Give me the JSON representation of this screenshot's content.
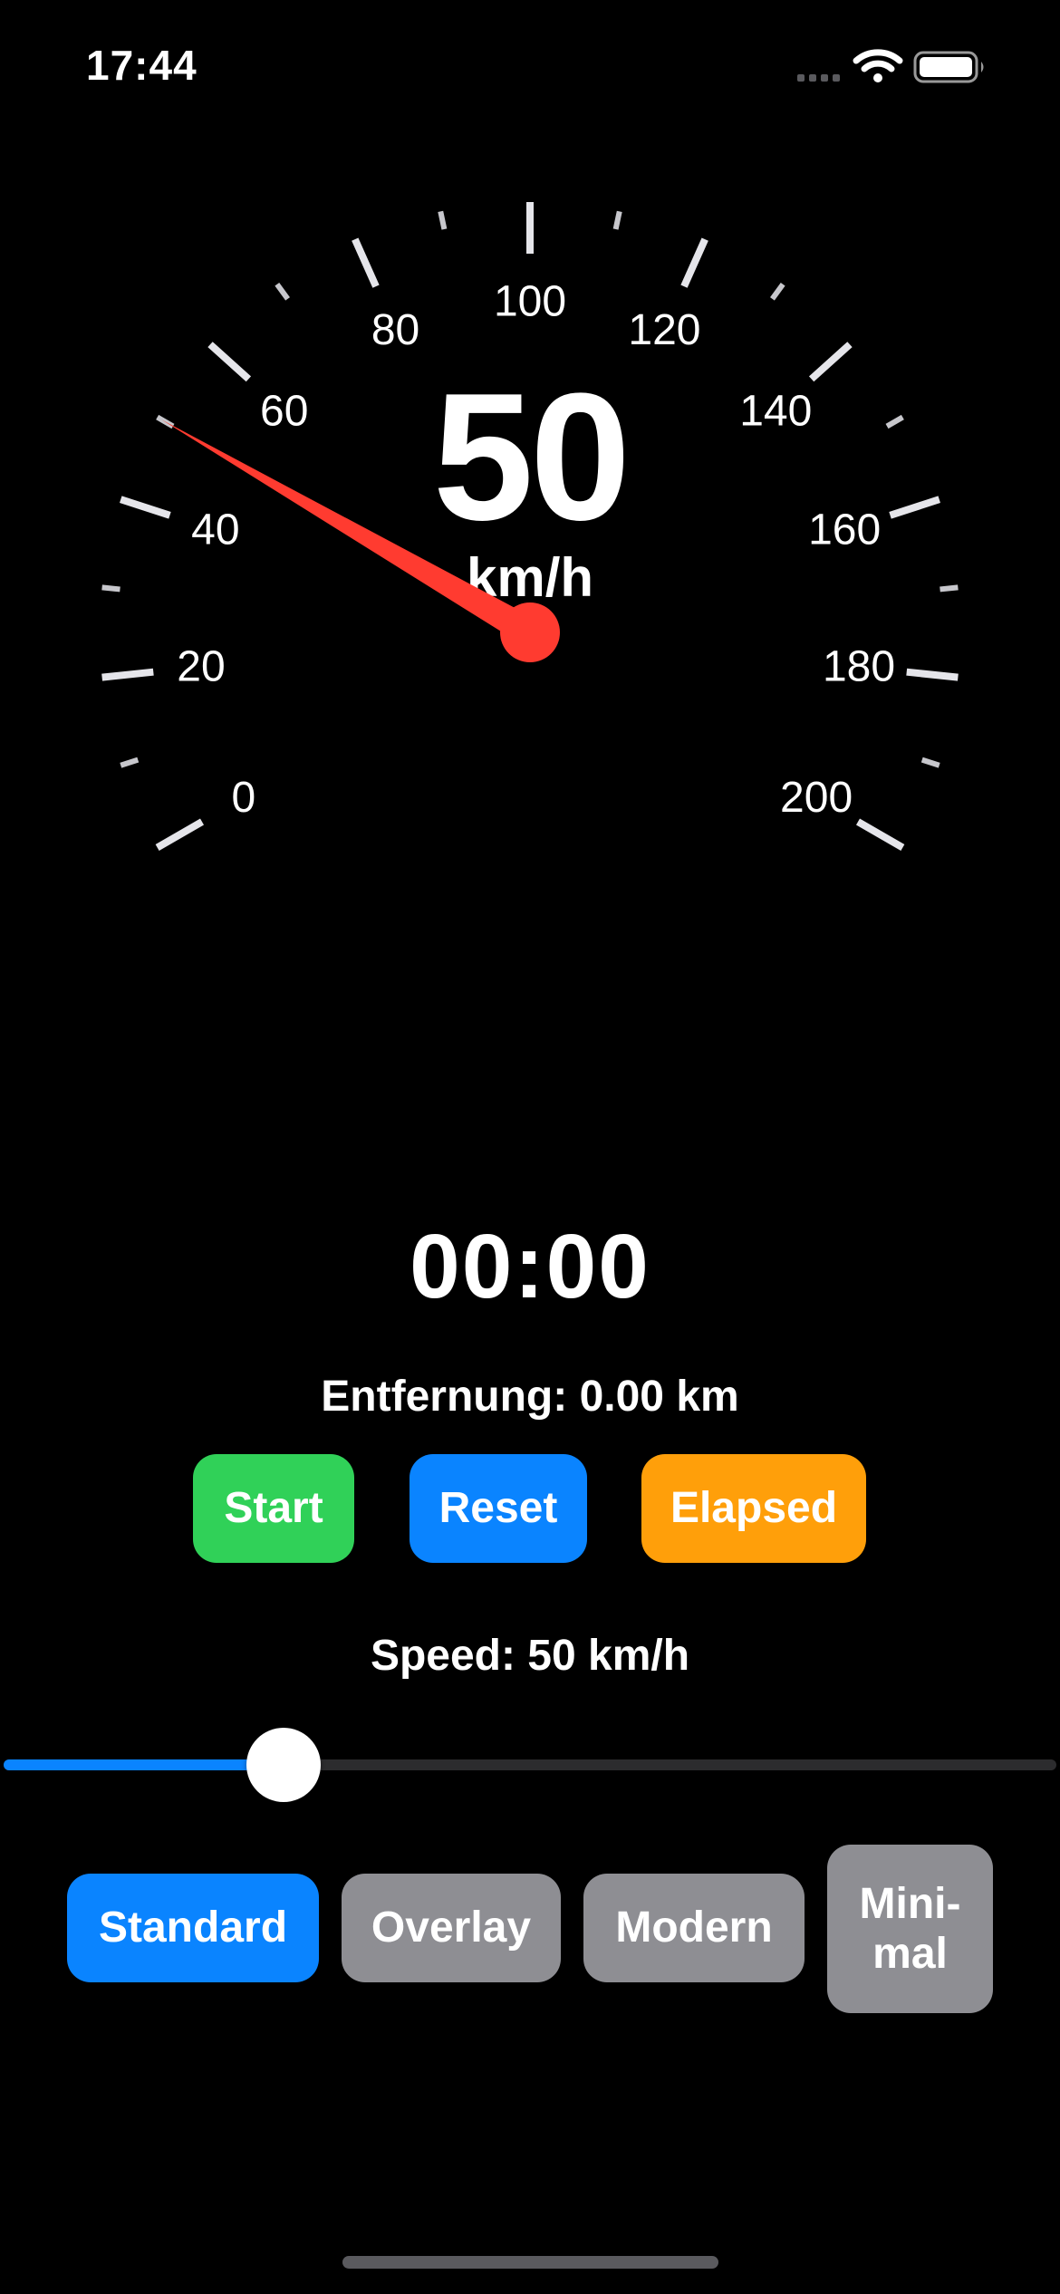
{
  "status_bar": {
    "time": "17:44",
    "icons": [
      "cellular-signal-icon",
      "wifi-icon",
      "battery-icon"
    ]
  },
  "speedometer": {
    "speed": "50",
    "unit": "km/h",
    "min": 0,
    "max": 200,
    "current_value": 50,
    "tick_labels": [
      "0",
      "20",
      "40",
      "60",
      "80",
      "100",
      "120",
      "140",
      "160",
      "180",
      "200"
    ],
    "needle_color": "#ff3b30"
  },
  "timer": {
    "elapsed": "00:00"
  },
  "distance": {
    "text": "Entfernung: 0.00 km"
  },
  "controls": {
    "start_label": "Start",
    "reset_label": "Reset",
    "elapsed_label": "Elapsed"
  },
  "speed_control": {
    "label": "Speed: 50 km/h",
    "value": 50,
    "min": 0,
    "max": 200
  },
  "display_modes": {
    "standard_label": "Standard",
    "overlay_label": "Overlay",
    "modern_label": "Modern",
    "minimal_label": "Mini-\nmal",
    "selected": "Standard"
  },
  "colors": {
    "start": "#30d158",
    "reset": "#0a84ff",
    "elapsed": "#ff9f0a",
    "selected_mode": "#0a84ff",
    "unselected_mode": "#8e8e93",
    "needle": "#ff3b30"
  }
}
